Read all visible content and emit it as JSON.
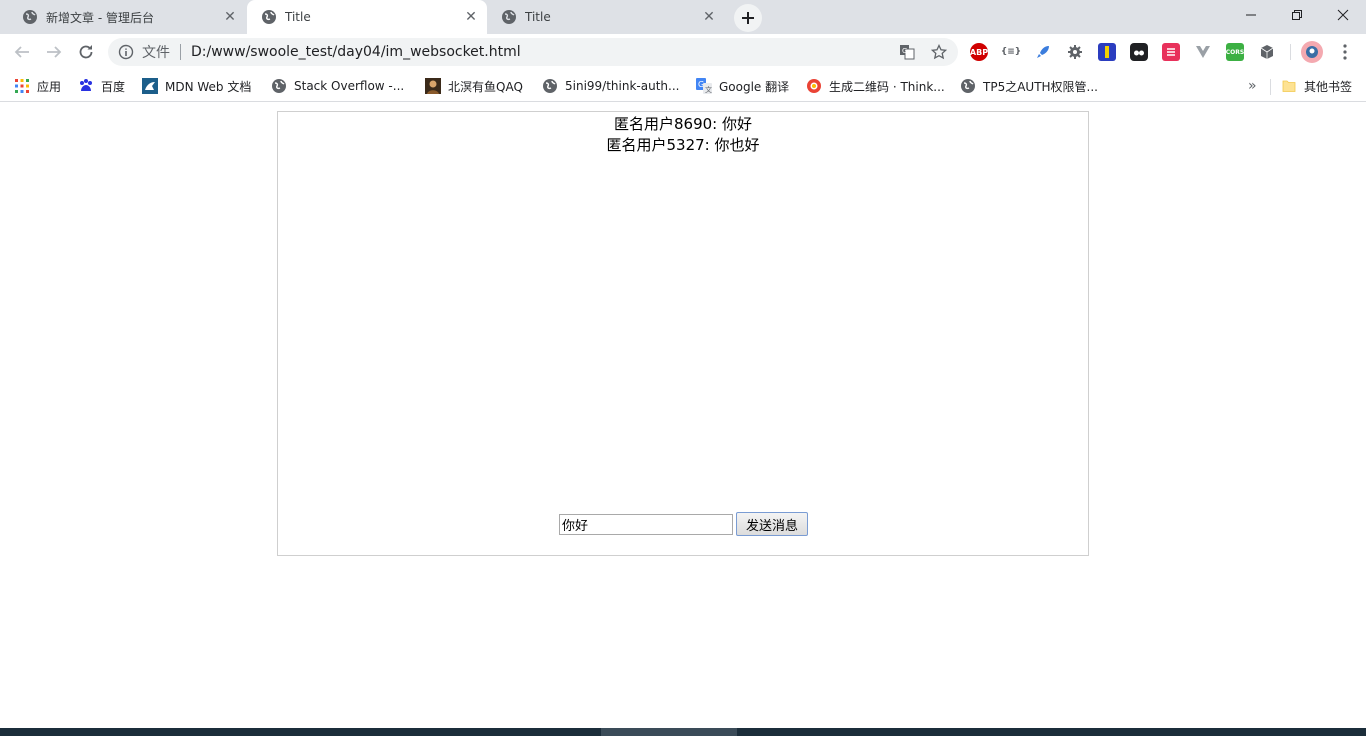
{
  "tabs": [
    {
      "title": "新增文章 - 管理后台",
      "active": false
    },
    {
      "title": "Title",
      "active": true
    },
    {
      "title": "Title",
      "active": false
    }
  ],
  "toolbar": {
    "scheme_label": "文件",
    "url": "D:/www/swoole_test/day04/im_websocket.html"
  },
  "extensions": [
    {
      "name": "adblock-icon",
      "label": "ABP",
      "color": "#d00000"
    },
    {
      "name": "json-viewer-icon",
      "label": "{≡}",
      "color": "#5f6368"
    },
    {
      "name": "rocket-icon",
      "label": "",
      "color": "#3b7ddd"
    },
    {
      "name": "gear-extension-icon",
      "label": "",
      "color": "#5f6368"
    },
    {
      "name": "ruler-extension-icon",
      "label": "",
      "color": "#2b3dbf"
    },
    {
      "name": "tampermonkey-icon",
      "label": "",
      "color": "#202124"
    },
    {
      "name": "postman-icon",
      "label": "",
      "color": "#e8315b"
    },
    {
      "name": "vue-devtools-icon",
      "label": "",
      "color": "#9aa0a6"
    },
    {
      "name": "cors-icon",
      "label": "CORS",
      "color": "#3cb043"
    },
    {
      "name": "cube-extension-icon",
      "label": "",
      "color": "#5f6368"
    }
  ],
  "bookmarks": [
    {
      "label": "应用",
      "icon": "apps-grid-icon"
    },
    {
      "label": "百度",
      "icon": "baidu-icon"
    },
    {
      "label": "MDN Web 文档",
      "icon": "mdn-icon"
    },
    {
      "label": "Stack Overflow -...",
      "icon": "globe-icon"
    },
    {
      "label": "北溟有鱼QAQ",
      "icon": "avatar-icon"
    },
    {
      "label": "5ini99/think-auth...",
      "icon": "globe-icon"
    },
    {
      "label": "Google 翻译",
      "icon": "google-translate-icon"
    },
    {
      "label": "生成二维码 · Think...",
      "icon": "qr-site-icon"
    },
    {
      "label": "TP5之AUTH权限管...",
      "icon": "globe-icon"
    }
  ],
  "other_bookmarks": "其他书签",
  "chat": {
    "messages": [
      "匿名用户8690: 你好",
      "匿名用户5327: 你也好"
    ],
    "input_value": "你好",
    "send_label": "发送消息"
  }
}
